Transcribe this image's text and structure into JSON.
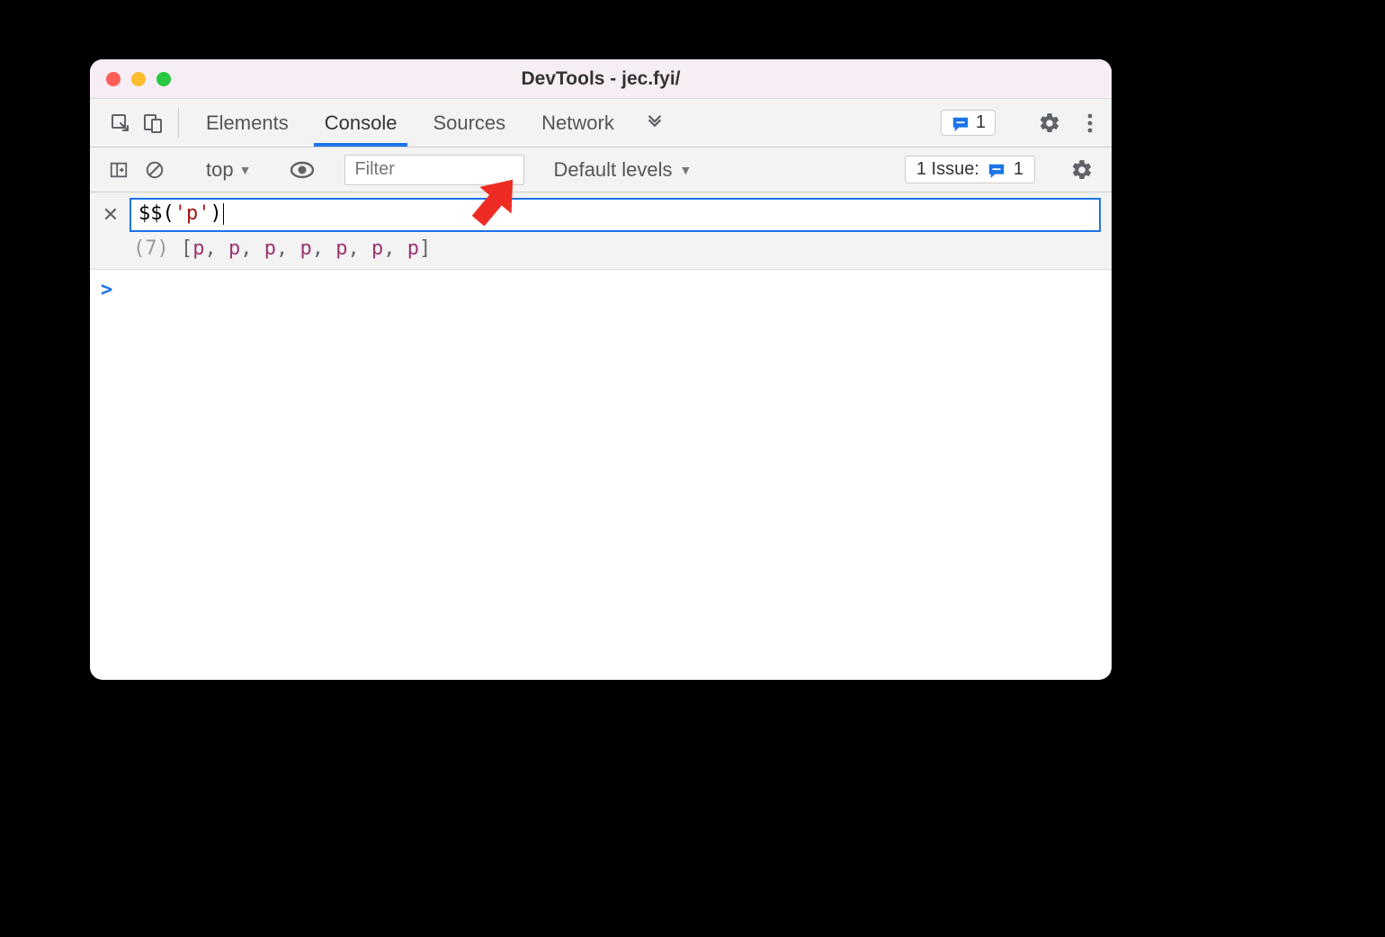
{
  "window": {
    "title": "DevTools - jec.fyi/"
  },
  "main_toolbar": {
    "tabs": [
      "Elements",
      "Console",
      "Sources",
      "Network"
    ],
    "active_tab_index": 1,
    "feedback_count": "1"
  },
  "sub_toolbar": {
    "context": "top",
    "filter_placeholder": "Filter",
    "levels_label": "Default levels",
    "issues_label": "1 Issue:",
    "issues_count": "1"
  },
  "console": {
    "input_code_parts": {
      "fn": "$$",
      "paren_open": "(",
      "str": "'p'",
      "paren_close": ")"
    },
    "result": {
      "count": "(7)",
      "elems": [
        "p",
        "p",
        "p",
        "p",
        "p",
        "p",
        "p"
      ]
    },
    "prompt": ">"
  }
}
